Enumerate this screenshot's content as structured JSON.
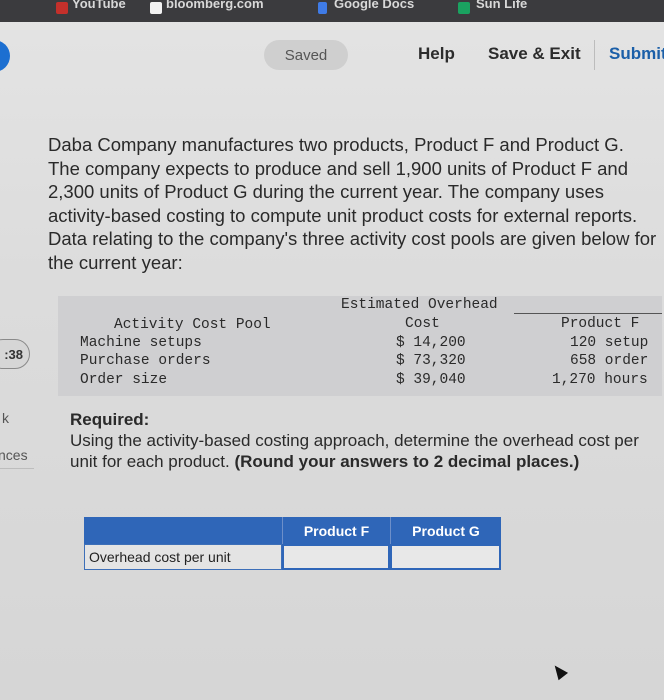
{
  "bookmarks": [
    {
      "label": "YouTube",
      "icon": "youtube-icon",
      "color": "#c4302b"
    },
    {
      "label": "bloomberg.com",
      "icon": "bookmark-icon",
      "color": "#f2f2f2"
    },
    {
      "label": "Google Docs",
      "icon": "docs-icon",
      "color": "#3f7be6"
    },
    {
      "label": "Sun Life",
      "icon": "sheets-icon",
      "color": "#1aa260"
    }
  ],
  "header": {
    "saved": "Saved",
    "help": "Help",
    "save_exit": "Save & Exit",
    "submit": "Submit"
  },
  "sidebar": {
    "timer": ":38",
    "item_k": "k",
    "item_ces": "nces"
  },
  "question": "Daba Company manufactures two products, Product F and Product G. The company expects to produce and sell 1,900 units of Product F and 2,300 units of Product G during the current year. The company uses activity-based costing to compute unit product costs for external reports. Data relating to the company's three activity cost pools are given below for the current year:",
  "data_table": {
    "col_pool": "Activity Cost Pool",
    "col_cost_line1": "Estimated Overhead",
    "col_cost_line2": "Cost",
    "col_product": "Product F",
    "rows": [
      {
        "pool": "Machine setups",
        "cost": "$ 14,200",
        "product": "120 setup"
      },
      {
        "pool": "Purchase orders",
        "cost": "$ 73,320",
        "product": "658 order"
      },
      {
        "pool": "Order size",
        "cost": "$ 39,040",
        "product": "1,270 hours"
      }
    ]
  },
  "required": {
    "title": "Required:",
    "text": "Using the activity-based costing approach, determine the overhead cost per unit for each product. ",
    "bold_text": "(Round your answers to 2 decimal places.)"
  },
  "answer_grid": {
    "col_f": "Product F",
    "col_g": "Product G",
    "row_label": "Overhead cost per unit",
    "value_f": "",
    "value_g": ""
  }
}
